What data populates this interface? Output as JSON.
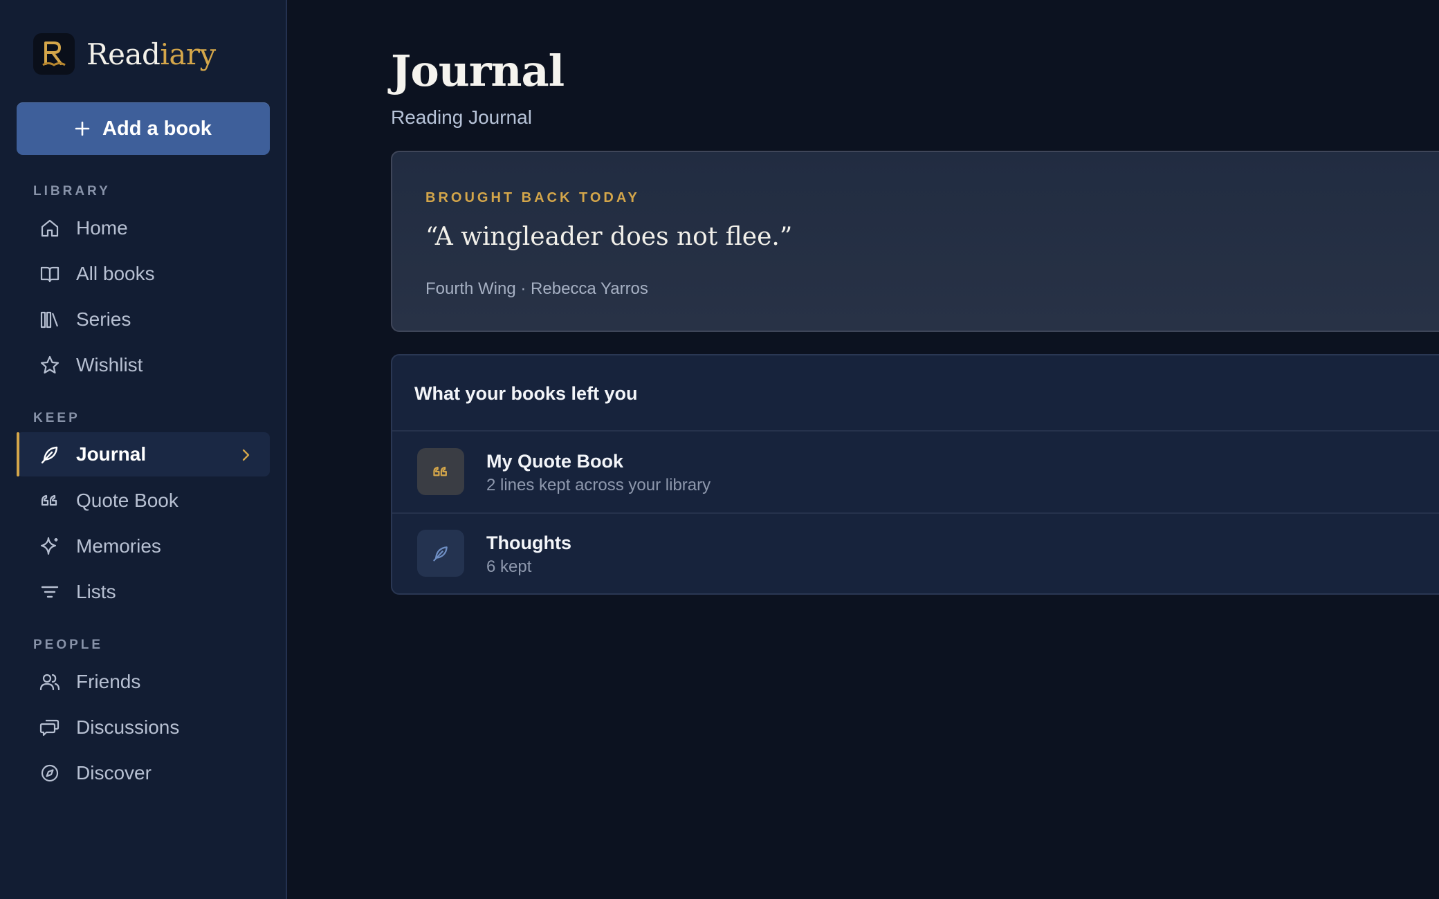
{
  "brand": {
    "name_main": "Read",
    "name_accent": "iary",
    "accent_color": "#d4a64a"
  },
  "add_book": {
    "label": "Add a book"
  },
  "sidebar": {
    "sections": [
      {
        "label": "LIBRARY",
        "items": [
          {
            "label": "Home",
            "icon": "home-icon"
          },
          {
            "label": "All books",
            "icon": "open-book-icon"
          },
          {
            "label": "Series",
            "icon": "series-icon"
          },
          {
            "label": "Wishlist",
            "icon": "star-icon"
          }
        ]
      },
      {
        "label": "KEEP",
        "items": [
          {
            "label": "Journal",
            "icon": "feather-icon",
            "active": true
          },
          {
            "label": "Quote Book",
            "icon": "quote-icon"
          },
          {
            "label": "Memories",
            "icon": "sparkle-icon"
          },
          {
            "label": "Lists",
            "icon": "filter-lines-icon"
          }
        ]
      },
      {
        "label": "PEOPLE",
        "items": [
          {
            "label": "Friends",
            "icon": "users-icon"
          },
          {
            "label": "Discussions",
            "icon": "chat-bubbles-icon"
          },
          {
            "label": "Discover",
            "icon": "compass-icon"
          }
        ]
      }
    ]
  },
  "page": {
    "title": "Journal",
    "subtitle": "Reading Journal"
  },
  "today": {
    "eyebrow": "BROUGHT BACK TODAY",
    "quote": "“A wingleader does not flee.”",
    "source": "Fourth Wing · Rebecca Yarros"
  },
  "left_you": {
    "title": "What your books left you",
    "rows": [
      {
        "title": "My Quote Book",
        "subtitle": "2 lines kept across your library",
        "icon": "quote-icon"
      },
      {
        "title": "Thoughts",
        "subtitle": "6 kept",
        "icon": "feather-icon"
      }
    ]
  }
}
